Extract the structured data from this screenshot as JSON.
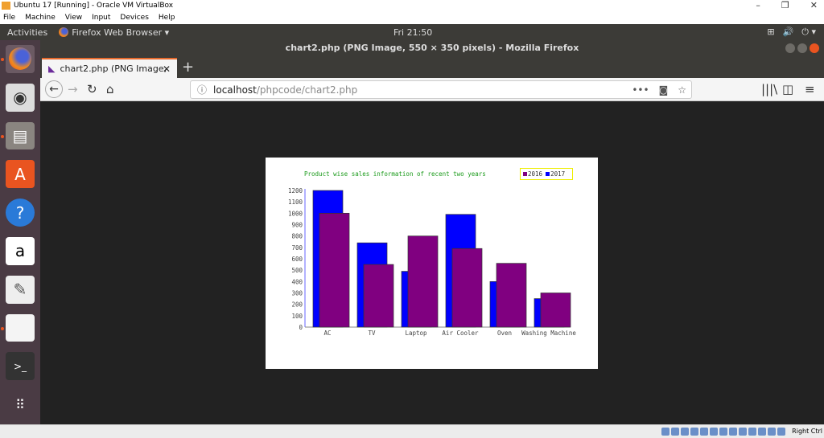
{
  "vbox": {
    "title": "Ubuntu 17 [Running] - Oracle VM VirtualBox",
    "menu": [
      "File",
      "Machine",
      "View",
      "Input",
      "Devices",
      "Help"
    ],
    "host_key": "Right Ctrl"
  },
  "topbar": {
    "activities": "Activities",
    "app": "Firefox Web Browser ▾",
    "clock": "Fri 21:50"
  },
  "launcher": [
    "firefox-icon",
    "rhythmbox-icon",
    "files-icon",
    "software-center-icon",
    "help-icon",
    "amazon-icon",
    "text-editor-icon",
    "libreoffice-icon",
    "terminal-icon",
    "show-apps-icon"
  ],
  "firefox": {
    "window_title": "chart2.php (PNG Image, 550 × 350 pixels) - Mozilla Firefox",
    "tab_title": "chart2.php (PNG Image,",
    "url_host": "localhost",
    "url_path": "/phpcode/chart2.php"
  },
  "chart_data": {
    "type": "bar",
    "title": "Product wise sales information of recent two years",
    "categories": [
      "AC",
      "TV",
      "Laptop",
      "Air Cooler",
      "Oven",
      "Washing Machine"
    ],
    "series": [
      {
        "name": "2016",
        "color": "#800080",
        "values": [
          1000,
          550,
          800,
          690,
          560,
          300
        ]
      },
      {
        "name": "2017",
        "color": "#0000ff",
        "values": [
          1200,
          740,
          490,
          990,
          400,
          250
        ]
      }
    ],
    "ylim": [
      0,
      1200
    ],
    "yticks": [
      0,
      100,
      200,
      300,
      400,
      500,
      600,
      700,
      800,
      900,
      1000,
      1100,
      1200
    ],
    "legend": "top-right",
    "grid": false
  }
}
